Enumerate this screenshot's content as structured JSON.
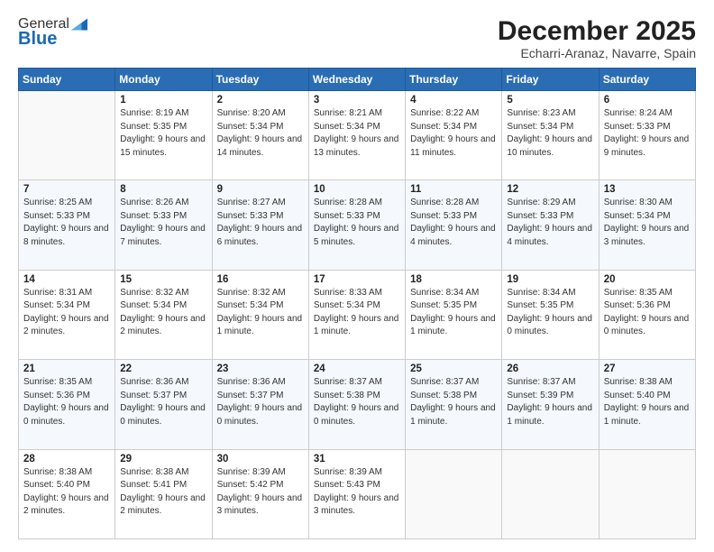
{
  "header": {
    "logo_general": "General",
    "logo_blue": "Blue",
    "title": "December 2025",
    "subtitle": "Echarri-Aranaz, Navarre, Spain"
  },
  "days_header": [
    "Sunday",
    "Monday",
    "Tuesday",
    "Wednesday",
    "Thursday",
    "Friday",
    "Saturday"
  ],
  "weeks": [
    [
      {
        "day": "",
        "sunrise": "",
        "sunset": "",
        "daylight": ""
      },
      {
        "day": "1",
        "sunrise": "Sunrise: 8:19 AM",
        "sunset": "Sunset: 5:35 PM",
        "daylight": "Daylight: 9 hours and 15 minutes."
      },
      {
        "day": "2",
        "sunrise": "Sunrise: 8:20 AM",
        "sunset": "Sunset: 5:34 PM",
        "daylight": "Daylight: 9 hours and 14 minutes."
      },
      {
        "day": "3",
        "sunrise": "Sunrise: 8:21 AM",
        "sunset": "Sunset: 5:34 PM",
        "daylight": "Daylight: 9 hours and 13 minutes."
      },
      {
        "day": "4",
        "sunrise": "Sunrise: 8:22 AM",
        "sunset": "Sunset: 5:34 PM",
        "daylight": "Daylight: 9 hours and 11 minutes."
      },
      {
        "day": "5",
        "sunrise": "Sunrise: 8:23 AM",
        "sunset": "Sunset: 5:34 PM",
        "daylight": "Daylight: 9 hours and 10 minutes."
      },
      {
        "day": "6",
        "sunrise": "Sunrise: 8:24 AM",
        "sunset": "Sunset: 5:33 PM",
        "daylight": "Daylight: 9 hours and 9 minutes."
      }
    ],
    [
      {
        "day": "7",
        "sunrise": "Sunrise: 8:25 AM",
        "sunset": "Sunset: 5:33 PM",
        "daylight": "Daylight: 9 hours and 8 minutes."
      },
      {
        "day": "8",
        "sunrise": "Sunrise: 8:26 AM",
        "sunset": "Sunset: 5:33 PM",
        "daylight": "Daylight: 9 hours and 7 minutes."
      },
      {
        "day": "9",
        "sunrise": "Sunrise: 8:27 AM",
        "sunset": "Sunset: 5:33 PM",
        "daylight": "Daylight: 9 hours and 6 minutes."
      },
      {
        "day": "10",
        "sunrise": "Sunrise: 8:28 AM",
        "sunset": "Sunset: 5:33 PM",
        "daylight": "Daylight: 9 hours and 5 minutes."
      },
      {
        "day": "11",
        "sunrise": "Sunrise: 8:28 AM",
        "sunset": "Sunset: 5:33 PM",
        "daylight": "Daylight: 9 hours and 4 minutes."
      },
      {
        "day": "12",
        "sunrise": "Sunrise: 8:29 AM",
        "sunset": "Sunset: 5:33 PM",
        "daylight": "Daylight: 9 hours and 4 minutes."
      },
      {
        "day": "13",
        "sunrise": "Sunrise: 8:30 AM",
        "sunset": "Sunset: 5:34 PM",
        "daylight": "Daylight: 9 hours and 3 minutes."
      }
    ],
    [
      {
        "day": "14",
        "sunrise": "Sunrise: 8:31 AM",
        "sunset": "Sunset: 5:34 PM",
        "daylight": "Daylight: 9 hours and 2 minutes."
      },
      {
        "day": "15",
        "sunrise": "Sunrise: 8:32 AM",
        "sunset": "Sunset: 5:34 PM",
        "daylight": "Daylight: 9 hours and 2 minutes."
      },
      {
        "day": "16",
        "sunrise": "Sunrise: 8:32 AM",
        "sunset": "Sunset: 5:34 PM",
        "daylight": "Daylight: 9 hours and 1 minute."
      },
      {
        "day": "17",
        "sunrise": "Sunrise: 8:33 AM",
        "sunset": "Sunset: 5:34 PM",
        "daylight": "Daylight: 9 hours and 1 minute."
      },
      {
        "day": "18",
        "sunrise": "Sunrise: 8:34 AM",
        "sunset": "Sunset: 5:35 PM",
        "daylight": "Daylight: 9 hours and 1 minute."
      },
      {
        "day": "19",
        "sunrise": "Sunrise: 8:34 AM",
        "sunset": "Sunset: 5:35 PM",
        "daylight": "Daylight: 9 hours and 0 minutes."
      },
      {
        "day": "20",
        "sunrise": "Sunrise: 8:35 AM",
        "sunset": "Sunset: 5:36 PM",
        "daylight": "Daylight: 9 hours and 0 minutes."
      }
    ],
    [
      {
        "day": "21",
        "sunrise": "Sunrise: 8:35 AM",
        "sunset": "Sunset: 5:36 PM",
        "daylight": "Daylight: 9 hours and 0 minutes."
      },
      {
        "day": "22",
        "sunrise": "Sunrise: 8:36 AM",
        "sunset": "Sunset: 5:37 PM",
        "daylight": "Daylight: 9 hours and 0 minutes."
      },
      {
        "day": "23",
        "sunrise": "Sunrise: 8:36 AM",
        "sunset": "Sunset: 5:37 PM",
        "daylight": "Daylight: 9 hours and 0 minutes."
      },
      {
        "day": "24",
        "sunrise": "Sunrise: 8:37 AM",
        "sunset": "Sunset: 5:38 PM",
        "daylight": "Daylight: 9 hours and 0 minutes."
      },
      {
        "day": "25",
        "sunrise": "Sunrise: 8:37 AM",
        "sunset": "Sunset: 5:38 PM",
        "daylight": "Daylight: 9 hours and 1 minute."
      },
      {
        "day": "26",
        "sunrise": "Sunrise: 8:37 AM",
        "sunset": "Sunset: 5:39 PM",
        "daylight": "Daylight: 9 hours and 1 minute."
      },
      {
        "day": "27",
        "sunrise": "Sunrise: 8:38 AM",
        "sunset": "Sunset: 5:40 PM",
        "daylight": "Daylight: 9 hours and 1 minute."
      }
    ],
    [
      {
        "day": "28",
        "sunrise": "Sunrise: 8:38 AM",
        "sunset": "Sunset: 5:40 PM",
        "daylight": "Daylight: 9 hours and 2 minutes."
      },
      {
        "day": "29",
        "sunrise": "Sunrise: 8:38 AM",
        "sunset": "Sunset: 5:41 PM",
        "daylight": "Daylight: 9 hours and 2 minutes."
      },
      {
        "day": "30",
        "sunrise": "Sunrise: 8:39 AM",
        "sunset": "Sunset: 5:42 PM",
        "daylight": "Daylight: 9 hours and 3 minutes."
      },
      {
        "day": "31",
        "sunrise": "Sunrise: 8:39 AM",
        "sunset": "Sunset: 5:43 PM",
        "daylight": "Daylight: 9 hours and 3 minutes."
      },
      {
        "day": "",
        "sunrise": "",
        "sunset": "",
        "daylight": ""
      },
      {
        "day": "",
        "sunrise": "",
        "sunset": "",
        "daylight": ""
      },
      {
        "day": "",
        "sunrise": "",
        "sunset": "",
        "daylight": ""
      }
    ]
  ]
}
